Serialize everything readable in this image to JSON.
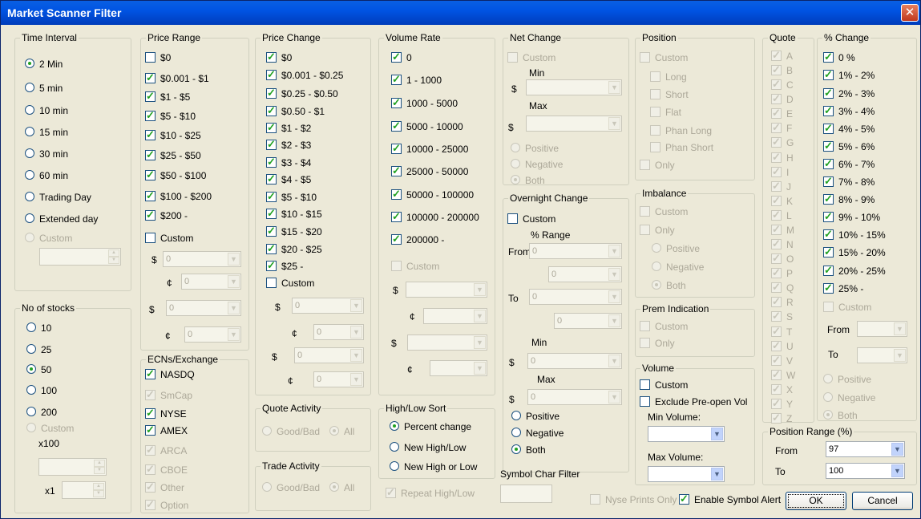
{
  "window": {
    "title": "Market Scanner Filter",
    "close_icon": "close-icon"
  },
  "time_interval": {
    "title": "Time Interval",
    "options": [
      "2 Min",
      "5 min",
      "10 min",
      "15 min",
      "30 min",
      "60 min",
      "Trading Day",
      "Extended day",
      "Custom"
    ],
    "selected": "2 Min"
  },
  "no_of_stocks": {
    "title": "No of stocks",
    "options": [
      "10",
      "25",
      "50",
      "100",
      "200",
      "Custom"
    ],
    "selected": "50",
    "x100": "x100",
    "x1": "x1"
  },
  "price_range": {
    "title": "Price Range",
    "items": [
      "$0",
      "$0.001 - $1",
      "$1 - $5",
      "$5 - $10",
      "$10 - $25",
      "$25 - $50",
      "$50 - $100",
      "$100 - $200",
      "$200 -",
      "Custom"
    ],
    "checked": [
      false,
      true,
      true,
      true,
      true,
      true,
      true,
      true,
      true,
      false
    ],
    "dollar": "$",
    "cent": "¢",
    "dd_value": "0"
  },
  "ecns": {
    "title": "ECNs/Exchange",
    "items": [
      "NASDQ",
      "SmCap",
      "NYSE",
      "AMEX",
      "ARCA",
      "CBOE",
      "Other",
      "Option"
    ],
    "enabled": [
      true,
      false,
      true,
      true,
      false,
      false,
      false,
      false
    ]
  },
  "price_change": {
    "title": "Price Change",
    "items": [
      "$0",
      "$0.001 - $0.25",
      "$0.25 - $0.50",
      "$0.50 - $1",
      "$1 - $2",
      "$2 - $3",
      "$3 - $4",
      "$4 - $5",
      "$5 - $10",
      "$10 - $15",
      "$15 - $20",
      "$20 - $25",
      "$25 -",
      "Custom"
    ],
    "checked": [
      true,
      true,
      true,
      true,
      true,
      true,
      true,
      true,
      true,
      true,
      true,
      true,
      true,
      false
    ],
    "dollar": "$",
    "cent": "¢",
    "dd_value": "0"
  },
  "quote_activity": {
    "title": "Quote Activity",
    "options": [
      "Good/Bad",
      "All"
    ],
    "selected": "All"
  },
  "trade_activity": {
    "title": "Trade Activity",
    "options": [
      "Good/Bad",
      "All"
    ],
    "selected": "All"
  },
  "volume_rate": {
    "title": "Volume Rate",
    "items": [
      "0",
      "1 - 1000",
      "1000 - 5000",
      "5000 - 10000",
      "10000 - 25000",
      "25000 - 50000",
      "50000 - 100000",
      "100000 - 200000",
      "200000 -",
      "Custom"
    ],
    "checked": [
      true,
      true,
      true,
      true,
      true,
      true,
      true,
      true,
      true,
      false
    ],
    "dollar": "$",
    "cent": "¢"
  },
  "high_low_sort": {
    "title": "High/Low Sort",
    "options": [
      "Percent change",
      "New High/Low",
      "New High or Low"
    ],
    "selected": "Percent change",
    "repeat": "Repeat High/Low"
  },
  "net_change": {
    "title": "Net Change",
    "custom": "Custom",
    "dollar": "$",
    "min": "Min",
    "max": "Max",
    "options": [
      "Positive",
      "Negative",
      "Both"
    ],
    "selected": "Both"
  },
  "overnight_change": {
    "title": "Overnight Change",
    "custom": "Custom",
    "range": "% Range",
    "from": "From",
    "to": "To",
    "min": "Min",
    "max": "Max",
    "dollar": "$",
    "dd_value": "0",
    "options": [
      "Positive",
      "Negative",
      "Both"
    ],
    "selected": "Both"
  },
  "symbol_char_filter": {
    "label": "Symbol Char Filter"
  },
  "position": {
    "title": "Position",
    "custom": "Custom",
    "items": [
      "Long",
      "Short",
      "Flat",
      "Phan Long",
      "Phan Short"
    ],
    "only": "Only"
  },
  "imbalance": {
    "title": "Imbalance",
    "custom": "Custom",
    "only": "Only",
    "options": [
      "Positive",
      "Negative",
      "Both"
    ],
    "selected": "Both"
  },
  "prem_indication": {
    "title": "Prem Indication",
    "custom": "Custom",
    "only": "Only"
  },
  "volume": {
    "title": "Volume",
    "custom": "Custom",
    "exclude": "Exclude Pre-open Vol",
    "min_label": "Min Volume:",
    "max_label": "Max Volume:"
  },
  "quote": {
    "title": "Quote",
    "letters": [
      "A",
      "B",
      "C",
      "D",
      "E",
      "F",
      "G",
      "H",
      "I",
      "J",
      "K",
      "L",
      "M",
      "N",
      "O",
      "P",
      "Q",
      "R",
      "S",
      "T",
      "U",
      "V",
      "W",
      "X",
      "Y",
      "Z"
    ]
  },
  "pct_change": {
    "title": "% Change",
    "items": [
      "0 %",
      "1% - 2%",
      "2% - 3%",
      "3% - 4%",
      "4% - 5%",
      "5% - 6%",
      "6% - 7%",
      "7% - 8%",
      "8% - 9%",
      "9% - 10%",
      "10% - 15%",
      "15% - 20%",
      "20% - 25%",
      "25% -"
    ],
    "custom": "Custom",
    "from": "From",
    "to": "To",
    "options": [
      "Positive",
      "Negative",
      "Both"
    ],
    "selected": "Both"
  },
  "position_range": {
    "title": "Position Range (%)",
    "from": "From",
    "to": "To",
    "from_value": "97",
    "to_value": "100"
  },
  "footer": {
    "nyse_prints_only": "Nyse Prints Only",
    "enable_symbol_alert": "Enable Symbol Alert",
    "ok": "OK",
    "cancel": "Cancel"
  },
  "colors": {
    "title_bar": "#0054E3",
    "check": "#21A121",
    "face": "#ECE9D8"
  }
}
